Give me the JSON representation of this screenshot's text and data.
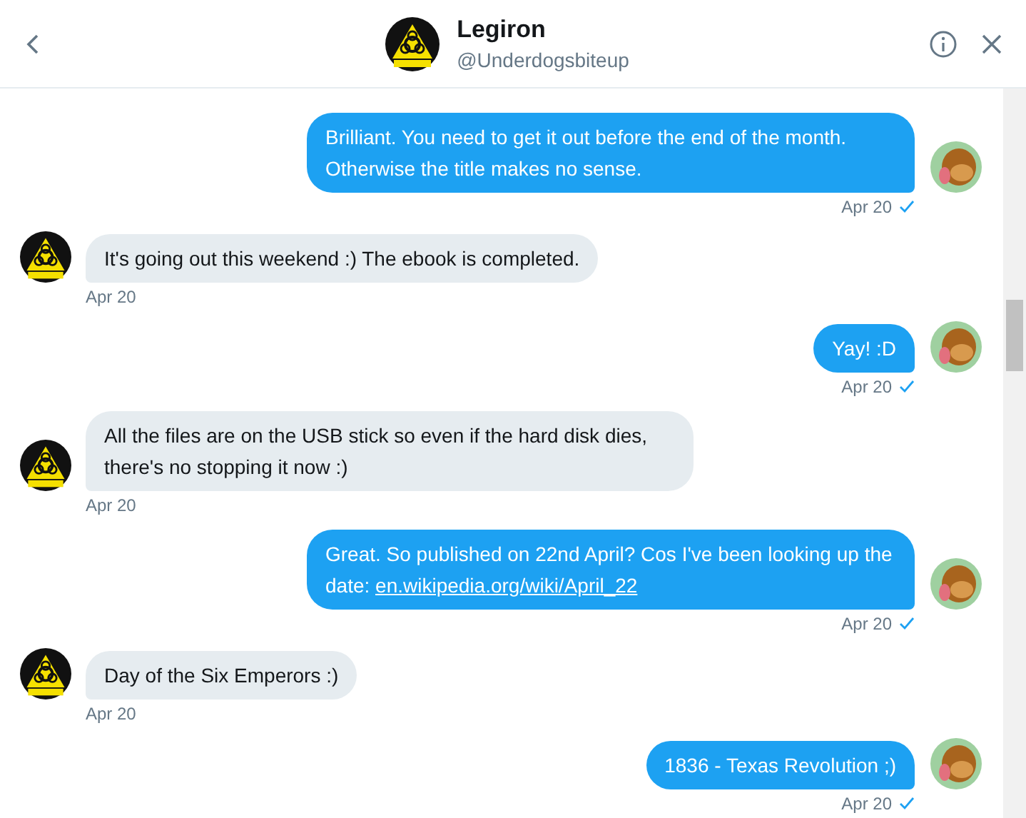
{
  "header": {
    "name": "Legiron",
    "handle": "@Underdogsbiteup"
  },
  "messages": [
    {
      "kind": "sent",
      "text": "Brilliant. You need to get it out before the end of the month. Otherwise the title makes no sense.",
      "time": "Apr 20",
      "read": true
    },
    {
      "kind": "received",
      "text": "It's going out this weekend :) The ebook is completed.",
      "time": "Apr 20"
    },
    {
      "kind": "sent",
      "text": "Yay! :D",
      "time": "Apr 20",
      "read": true
    },
    {
      "kind": "received",
      "text": "All the files are on the USB stick so even if the hard disk dies, there's no stopping it now :)",
      "time": "Apr 20"
    },
    {
      "kind": "sent",
      "text": "Great. So published on 22nd April? Cos I've been looking up the date: ",
      "link": "en.wikipedia.org/wiki/April_22",
      "time": "Apr 20",
      "read": true
    },
    {
      "kind": "received",
      "text": "Day of the Six Emperors :)",
      "time": "Apr 20"
    },
    {
      "kind": "sent",
      "text": "1836 - Texas Revolution ;)",
      "time": "Apr 20",
      "read": true
    }
  ]
}
